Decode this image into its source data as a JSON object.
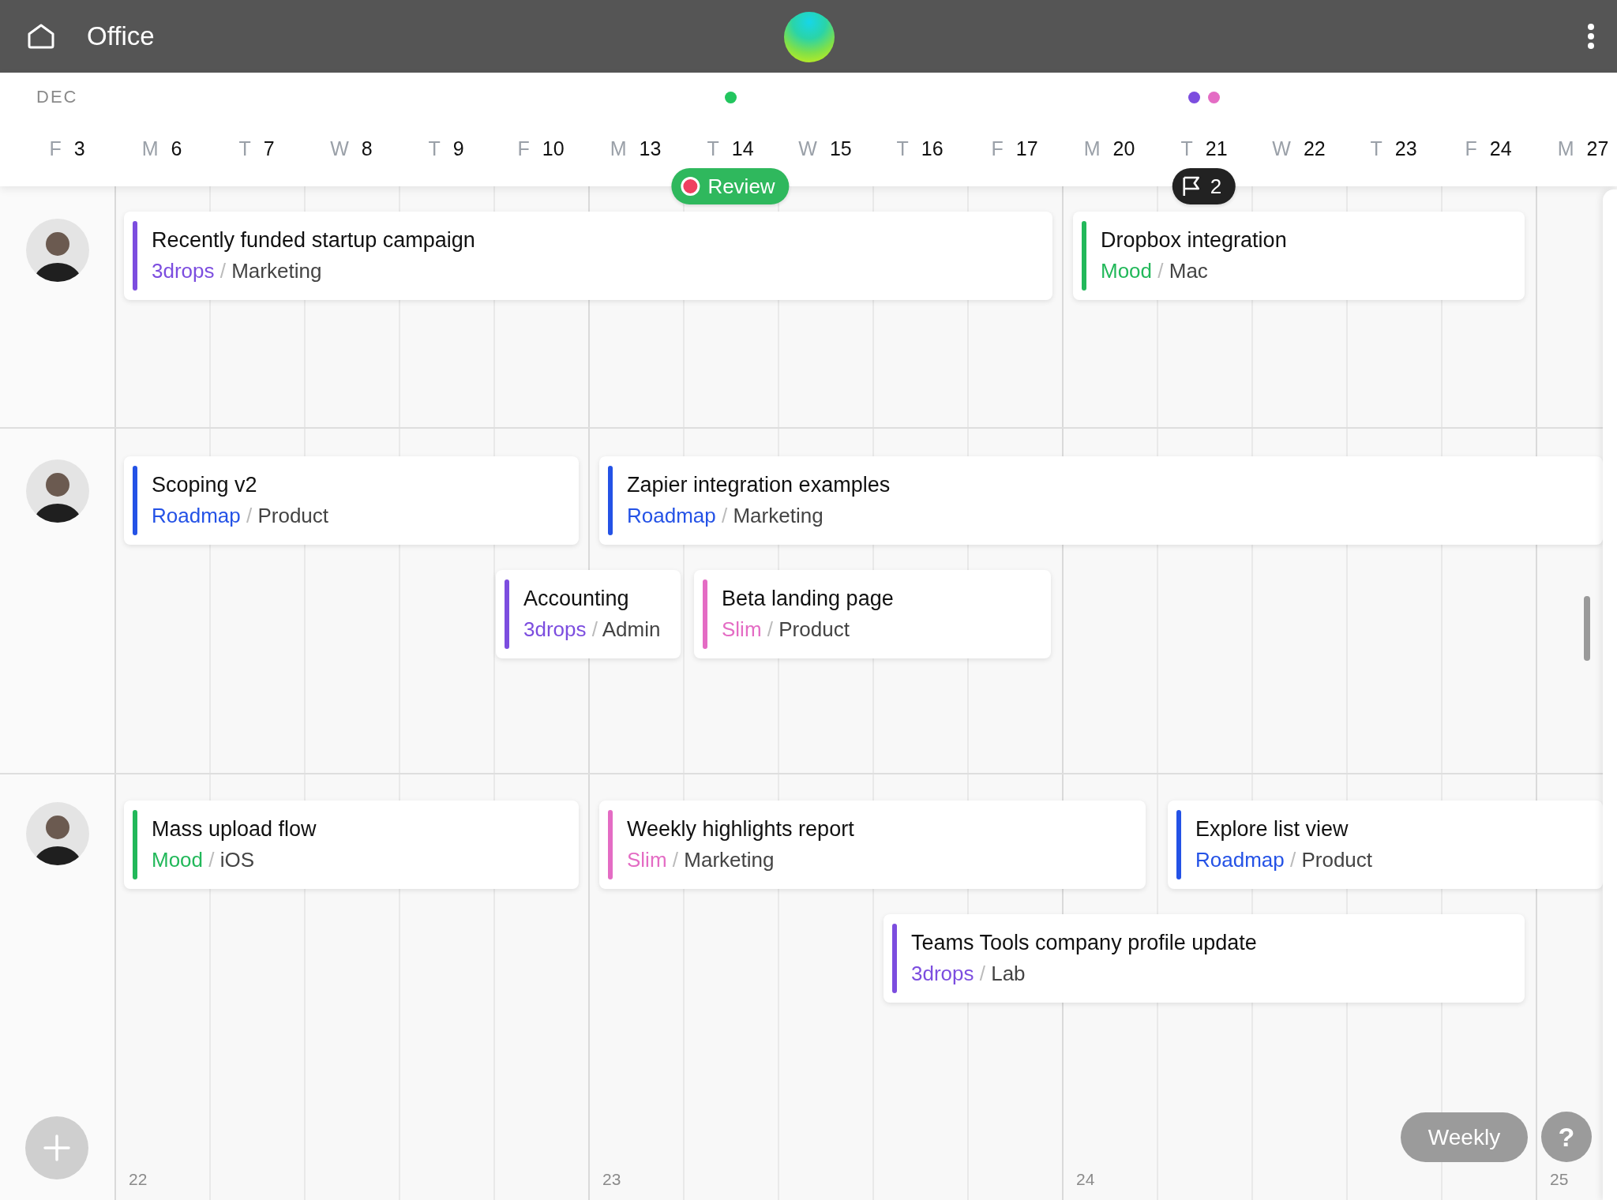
{
  "app_bar": {
    "title": "Office"
  },
  "calendar": {
    "month": "DEC",
    "days": [
      {
        "weekday": "F",
        "date": "3"
      },
      {
        "weekday": "M",
        "date": "6"
      },
      {
        "weekday": "T",
        "date": "7"
      },
      {
        "weekday": "W",
        "date": "8"
      },
      {
        "weekday": "T",
        "date": "9"
      },
      {
        "weekday": "F",
        "date": "10"
      },
      {
        "weekday": "M",
        "date": "13"
      },
      {
        "weekday": "T",
        "date": "14",
        "dots": [
          {
            "color": "#22c55e"
          }
        ],
        "badge": {
          "kind": "review",
          "label": "Review"
        }
      },
      {
        "weekday": "W",
        "date": "15"
      },
      {
        "weekday": "T",
        "date": "16"
      },
      {
        "weekday": "F",
        "date": "17"
      },
      {
        "weekday": "M",
        "date": "20"
      },
      {
        "weekday": "T",
        "date": "21",
        "dots": [
          {
            "color": "#7c4ddf"
          },
          {
            "color": "#e46cc4"
          }
        ],
        "badge": {
          "kind": "flag",
          "label": "2"
        }
      },
      {
        "weekday": "W",
        "date": "22"
      },
      {
        "weekday": "T",
        "date": "23"
      },
      {
        "weekday": "F",
        "date": "24"
      },
      {
        "weekday": "M",
        "date": "27"
      }
    ]
  },
  "people": [
    {
      "lanes": [
        [
          {
            "title": "Recently funded startup campaign",
            "project": "3drops",
            "separator": "/",
            "area": "Marketing",
            "color": "#7c4ddf"
          },
          {
            "title": "Dropbox integration",
            "project": "Mood",
            "separator": "/",
            "area": "Mac",
            "color": "#22b85a"
          }
        ]
      ]
    },
    {
      "lanes": [
        [
          {
            "title": "Scoping v2",
            "project": "Roadmap",
            "separator": "/",
            "area": "Product",
            "color": "#2452e6"
          },
          {
            "title": "Zapier integration examples",
            "project": "Roadmap",
            "separator": "/",
            "area": "Marketing",
            "color": "#2452e6"
          }
        ],
        [
          {
            "title": "Accounting",
            "project": "3drops",
            "separator": "/",
            "area": "Admin",
            "color": "#7c4ddf"
          },
          {
            "title": "Beta landing page",
            "project": "Slim",
            "separator": "/",
            "area": "Product",
            "color": "#e46cc4"
          }
        ]
      ]
    },
    {
      "lanes": [
        [
          {
            "title": "Mass upload flow",
            "project": "Mood",
            "separator": "/",
            "area": "iOS",
            "color": "#22b85a"
          },
          {
            "title": "Weekly highlights report",
            "project": "Slim",
            "separator": "/",
            "area": "Marketing",
            "color": "#e46cc4"
          },
          {
            "title": "Explore list view",
            "project": "Roadmap",
            "separator": "/",
            "area": "Product",
            "color": "#2452e6"
          }
        ],
        [
          {
            "title": "Teams Tools company profile update",
            "project": "3drops",
            "separator": "/",
            "area": "Lab",
            "color": "#7c4ddf"
          }
        ]
      ]
    }
  ],
  "week_numbers": [
    "22",
    "23",
    "24",
    "25"
  ],
  "view_button": "Weekly",
  "help_button": "?"
}
